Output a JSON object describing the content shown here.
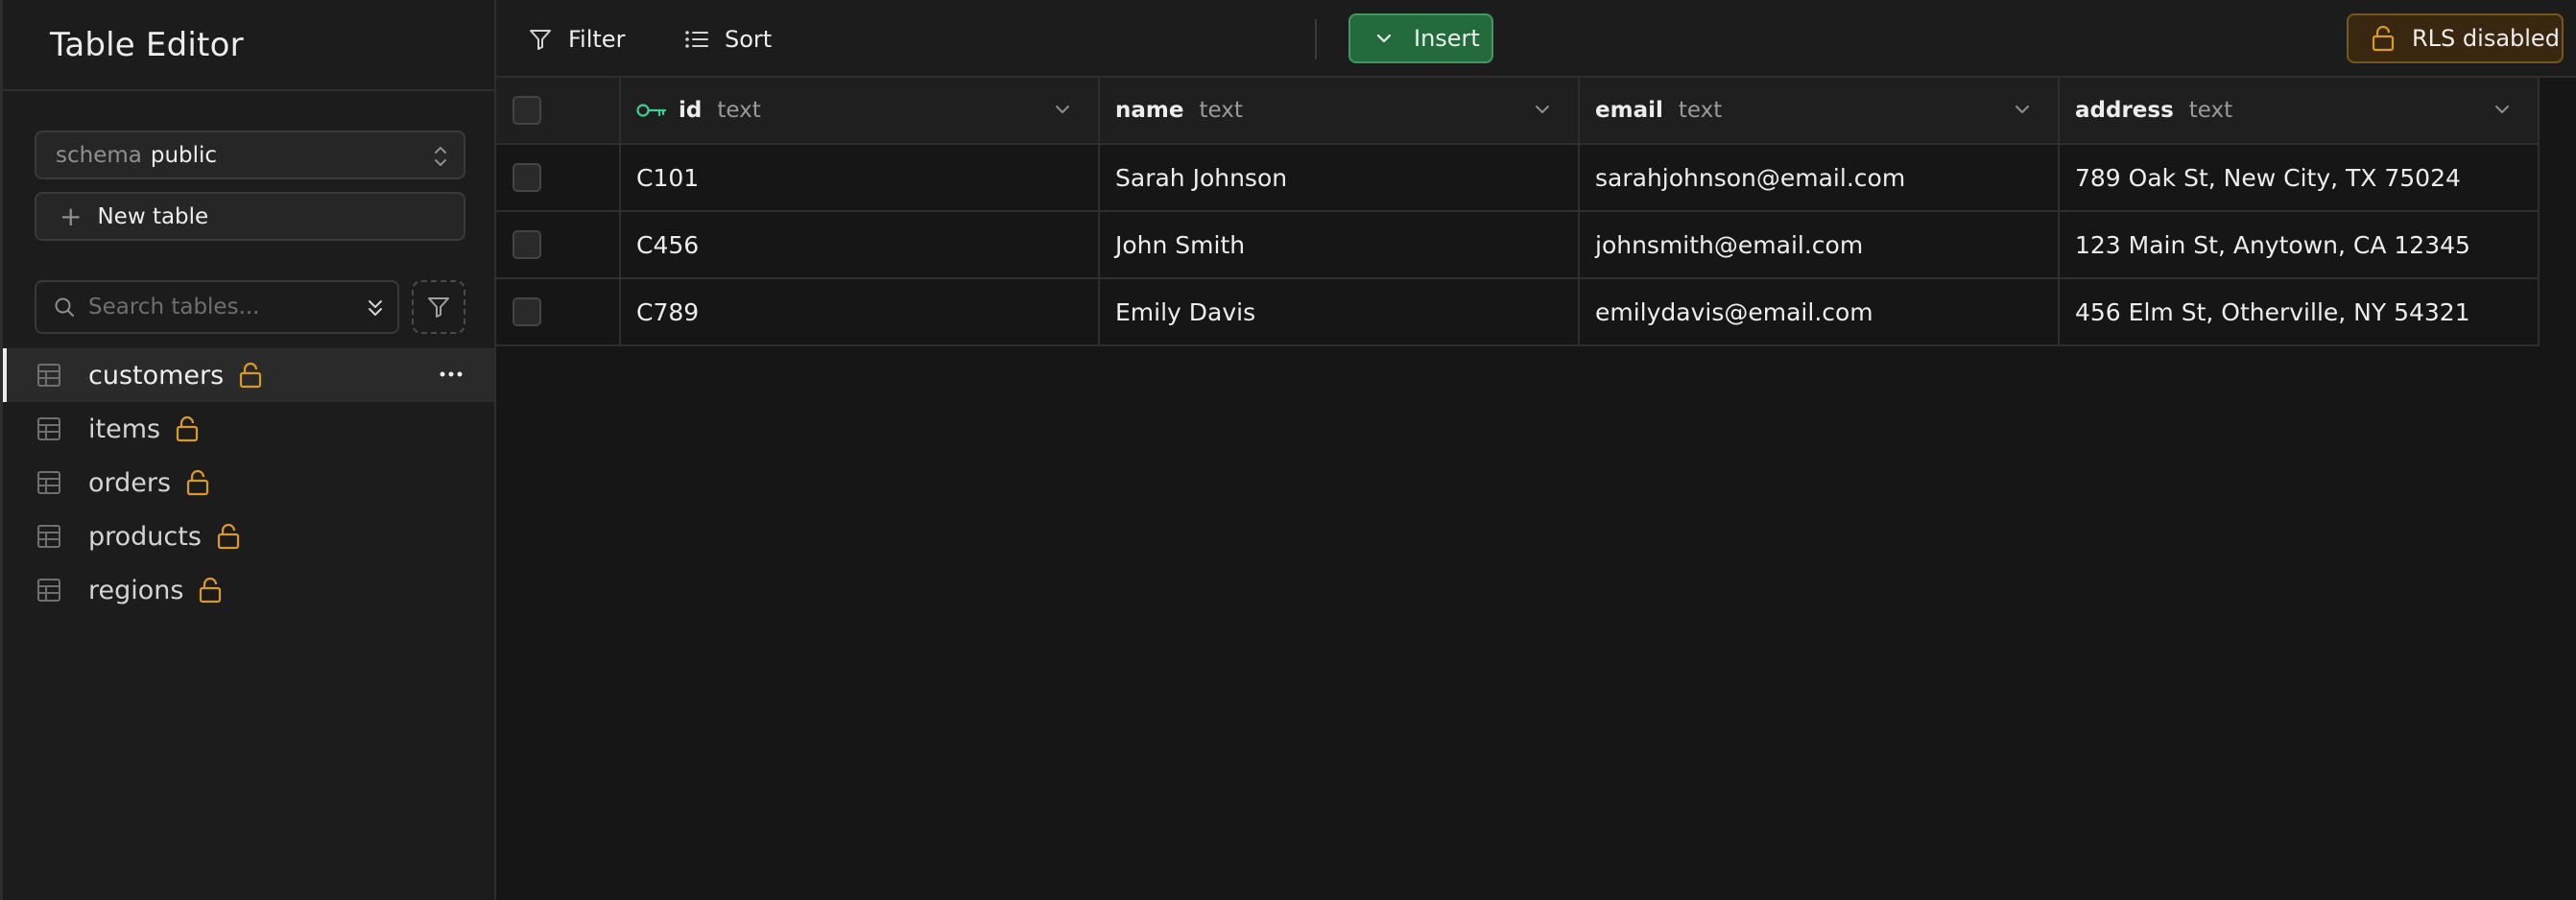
{
  "sidebar": {
    "title": "Table Editor",
    "schema": {
      "label": "schema",
      "value": "public"
    },
    "new_table_label": "New table",
    "search_placeholder": "Search tables...",
    "tables": [
      {
        "name": "customers",
        "active": true
      },
      {
        "name": "items",
        "active": false
      },
      {
        "name": "orders",
        "active": false
      },
      {
        "name": "products",
        "active": false
      },
      {
        "name": "regions",
        "active": false
      }
    ]
  },
  "toolbar": {
    "filter_label": "Filter",
    "sort_label": "Sort",
    "insert_label": "Insert",
    "rls_label": "RLS disabled"
  },
  "grid": {
    "columns": [
      {
        "name": "id",
        "type": "text",
        "primary_key": true
      },
      {
        "name": "name",
        "type": "text"
      },
      {
        "name": "email",
        "type": "text"
      },
      {
        "name": "address",
        "type": "text"
      }
    ],
    "rows": [
      {
        "id": "C101",
        "name": "Sarah Johnson",
        "email": "sarahjohnson@email.com",
        "address": "789 Oak St, New City, TX 75024"
      },
      {
        "id": "C456",
        "name": "John Smith",
        "email": "johnsmith@email.com",
        "address": "123 Main St, Anytown, CA 12345"
      },
      {
        "id": "C789",
        "name": "Emily Davis",
        "email": "emilydavis@email.com",
        "address": "456 Elm St, Otherville, NY 54321"
      }
    ]
  },
  "colors": {
    "background": "#161616",
    "sidebar": "#1c1c1c",
    "insert_green": "#236b3d",
    "key_green": "#3ecf8e",
    "lock_amber": "#d99a2b",
    "rls_bg": "#3a2710"
  }
}
